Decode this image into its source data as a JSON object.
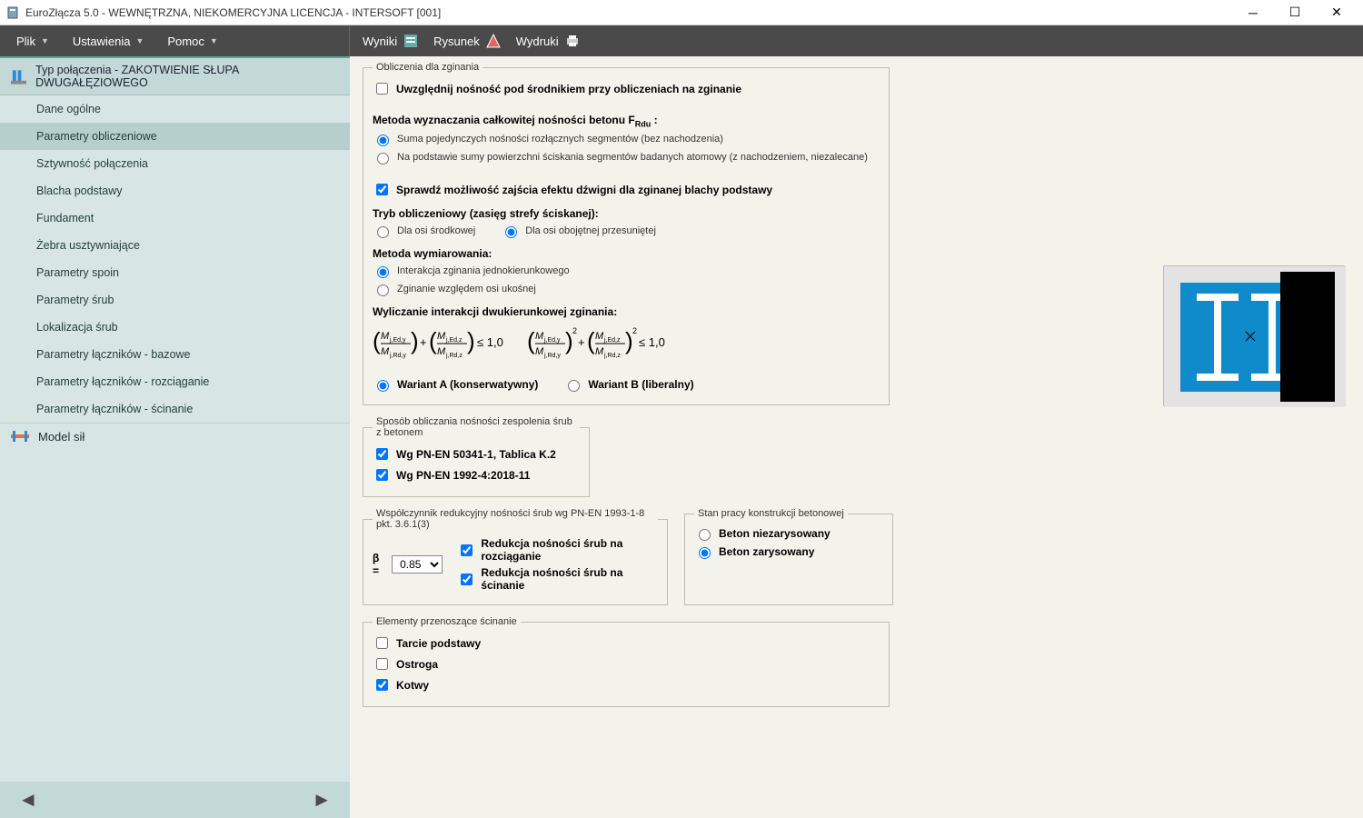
{
  "window": {
    "title": "EuroZłącza 5.0 - WEWNĘTRZNA, NIEKOMERCYJNA LICENCJA - INTERSOFT [001]"
  },
  "menubar": {
    "items": [
      "Plik",
      "Ustawienia",
      "Pomoc"
    ]
  },
  "toolbar": {
    "items": [
      "Wyniki",
      "Rysunek",
      "Wydruki"
    ]
  },
  "sidebar": {
    "header": "Typ połączenia - ZAKOTWIENIE SŁUPA DWUGAŁĘZIOWEGO",
    "items": [
      "Dane ogólne",
      "Parametry obliczeniowe",
      "Sztywność połączenia",
      "Blacha podstawy",
      "Fundament",
      "Żebra usztywniające",
      "Parametry spoin",
      "Parametry śrub",
      "Lokalizacja śrub",
      "Parametry łączników - bazowe",
      "Parametry łączników - rozciąganie",
      "Parametry łączników - ścinanie"
    ],
    "active_index": 1,
    "section2": "Model sił"
  },
  "form": {
    "group1_title": "Obliczenia dla zginania",
    "cb_uwzglednij": "Uwzględnij nośność pod środnikiem przy obliczeniach na zginanie",
    "method_heading_pre": "Metoda wyznaczania całkowitej nośności betonu F",
    "method_heading_sub": "Rdu",
    "method_heading_post": " :",
    "r_method1": "Suma pojedynczych nośności rozłącznych segmentów (bez nachodzenia)",
    "r_method2": "Na podstawie sumy powierzchni ściskania segmentów badanych atomowy (z nachodzeniem, niezalecane)",
    "cb_lever": "Sprawdź możliwość zajścia efektu dźwigni dla zginanej blachy podstawy",
    "mode_heading": "Tryb obliczeniowy (zasięg strefy ściskanej):",
    "r_mode1": "Dla osi środkowej",
    "r_mode2": "Dla osi obojętnej przesuniętej",
    "dim_heading": "Metoda wymiarowania:",
    "r_dim1": "Interakcja zginania jednokierunkowego",
    "r_dim2": "Zginanie względem osi ukośnej",
    "interaction_heading": "Wyliczanie interakcji dwukierunkowej zginania:",
    "r_varA": "Wariant A (konserwatywny)",
    "r_varB": "Wariant B (liberalny)",
    "group2_title": "Sposób obliczania nośności zespolenia śrub z betonem",
    "cb_pn1": "Wg PN-EN 50341-1, Tablica K.2",
    "cb_pn2": "Wg PN-EN 1992-4:2018-11",
    "group3_title": "Współczynnik redukcyjny nośności śrub wg PN-EN 1993-1-8 pkt. 3.6.1(3)",
    "beta_label": "β  =",
    "beta_value": "0.85",
    "cb_red1": "Redukcja nośności śrub na rozciąganie",
    "cb_red2": "Redukcja nośności śrub na ścinanie",
    "group4_title": "Stan pracy konstrukcji betonowej",
    "r_beton1": "Beton niezarysowany",
    "r_beton2": "Beton zarysowany",
    "group5_title": "Elementy przenoszące ścinanie",
    "cb_tarcie": "Tarcie podstawy",
    "cb_ostroga": "Ostroga",
    "cb_kotwy": "Kotwy"
  }
}
